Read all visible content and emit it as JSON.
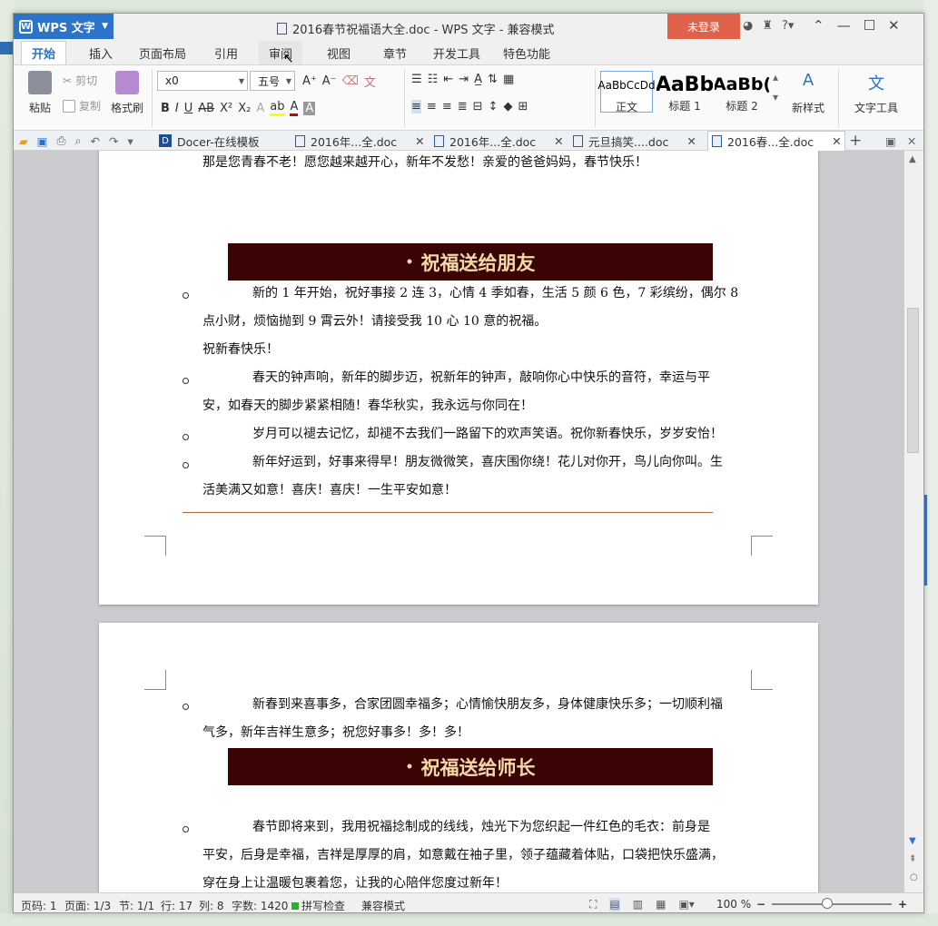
{
  "app": {
    "name": "WPS 文字",
    "title": "2016春节祝福语大全.doc - WPS 文字 - 兼容模式",
    "login": "未登录"
  },
  "menu_tabs": [
    "开始",
    "插入",
    "页面布局",
    "引用",
    "审阅",
    "视图",
    "章节",
    "开发工具",
    "特色功能"
  ],
  "ribbon": {
    "paste": "粘贴",
    "cut": "剪切",
    "copy": "复制",
    "format_painter": "格式刷",
    "font_name": "x0",
    "font_size": "五号",
    "styles": [
      {
        "preview": "AaBbCcDd",
        "label": "正文"
      },
      {
        "preview": "AaBb",
        "label": "标题 1"
      },
      {
        "preview": "AaBb(",
        "label": "标题 2"
      }
    ],
    "new_style": "新样式",
    "text_tools": "文字工具"
  },
  "doc_tabs": [
    "Docer-在线模板",
    "2016年...全.doc",
    "2016年...全.doc",
    "元旦搞笑....doc",
    "2016春...全.doc"
  ],
  "document": {
    "top_line": "那是您青春不老！愿您越来越开心，新年不发愁！亲爱的爸爸妈妈，春节快乐！",
    "heading1": "祝福送给朋友",
    "p1_l1": "新的 1 年开始，祝好事接 2 连 3，心情 4 季如春，生活 5 颜 6 色，7 彩缤纷，偶尔 8",
    "p1_l2": "点小财，烦恼抛到 9 霄云外！请接受我 10 心 10 意的祝福。",
    "p1_l3": "祝新春快乐！",
    "p2_l1": "春天的钟声响，新年的脚步迈，祝新年的钟声，敲响你心中快乐的音符，幸运与平",
    "p2_l2": "安，如春天的脚步紧紧相随！春华秋实，我永远与你同在！",
    "p3_l1": "岁月可以褪去记忆，却褪不去我们一路留下的欢声笑语。祝你新春快乐，岁岁安怡！",
    "p4_l1": "新年好运到，好事来得早！朋友微微笑，喜庆围你绕！花儿对你开，鸟儿向你叫。生",
    "p4_l2": "活美满又如意！喜庆！喜庆！一生平安如意！",
    "p5_l1": "新春到来喜事多，合家团圆幸福多；心情愉快朋友多，身体健康快乐多；一切顺利福",
    "p5_l2": "气多，新年吉祥生意多；祝您好事多！多！多！",
    "heading2": "祝福送给师长",
    "p6_l1": "春节即将来到，我用祝福捻制成的线线，烛光下为您织起一件红色的毛衣：前身是",
    "p6_l2": "平安，后身是幸福，吉祥是厚厚的肩，如意戴在袖子里，领子蕴藏着体贴，口袋把快乐盛满，",
    "p6_l3": "穿在身上让温暖包裹着您，让我的心陪伴您度过新年！"
  },
  "status": {
    "page_num": "页码: 1",
    "pages": "页面: 1/3",
    "section": "节: 1/1",
    "row": "行: 17",
    "col": "列: 8",
    "words": "字数: 1420",
    "spell": "拼写检查",
    "mode": "兼容模式",
    "zoom": "100 %"
  },
  "colors": {
    "accent": "#2b74c7",
    "heading_bg": "#3b0404",
    "heading_text": "#f3d9a8",
    "login_bg": "#e0614a"
  }
}
